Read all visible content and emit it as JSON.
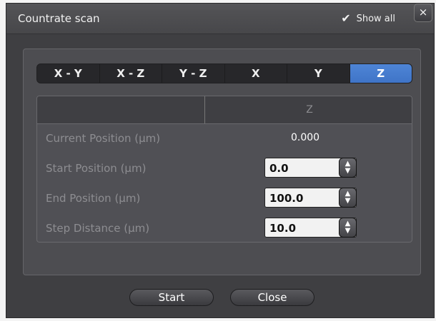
{
  "window": {
    "title": "Countrate scan",
    "show_all_label": "Show all",
    "close_glyph": "×"
  },
  "tabs": [
    {
      "label": "X - Y",
      "active": false
    },
    {
      "label": "X - Z",
      "active": false
    },
    {
      "label": "Y - Z",
      "active": false
    },
    {
      "label": "X",
      "active": false
    },
    {
      "label": "Y",
      "active": false
    },
    {
      "label": "Z",
      "active": true
    }
  ],
  "table": {
    "header": {
      "left": "",
      "right": "Z"
    },
    "rows": [
      {
        "label": "Current Position (µm)",
        "value": "0.000"
      },
      {
        "label": "Start Position (µm)",
        "value": "0.0"
      },
      {
        "label": "End Position (µm)",
        "value": "100.0"
      },
      {
        "label": "Step Distance (µm)",
        "value": "10.0"
      }
    ]
  },
  "buttons": {
    "start": "Start",
    "close": "Close"
  },
  "colors": {
    "accent": "#4a7fd1",
    "panel": "#4d4d51",
    "window": "#3f3f42"
  }
}
